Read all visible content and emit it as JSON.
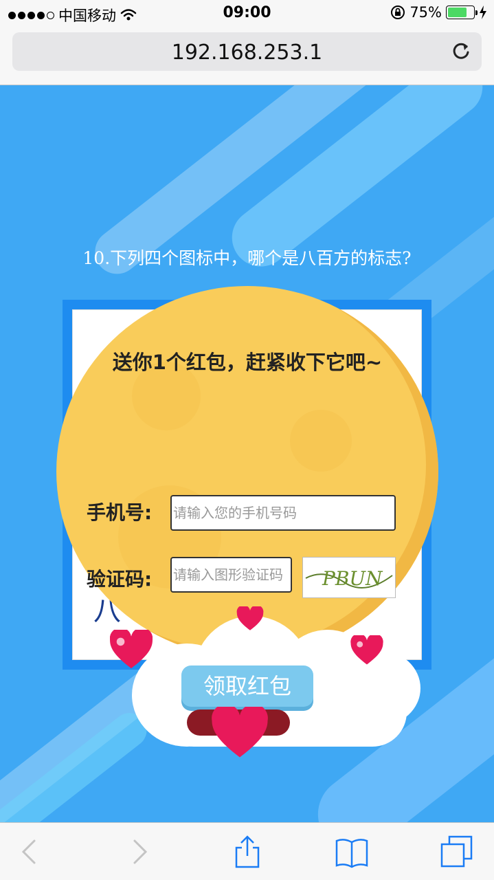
{
  "status": {
    "carrier": "中国移动",
    "time": "09:00",
    "battery": "75%",
    "battery_level": 0.75
  },
  "browser": {
    "url": "192.168.253.1"
  },
  "quiz": {
    "question": "10.下列四个图标中，哪个是八百方的标志?",
    "partial_option_text": "八"
  },
  "popup": {
    "title": "送你1个红包，赶紧收下它吧~",
    "phone_label": "手机号:",
    "phone_placeholder": "请输入您的手机号码",
    "code_label": "验证码:",
    "code_placeholder": "请输入图形验证码",
    "captcha_text": "PBUN",
    "button_label": "领取红包"
  },
  "colors": {
    "page_bg": "#3fa8f4",
    "moon": "#f9cc5a",
    "button": "#7cc9ee",
    "heart": "#e8195a",
    "frame": "#1e8cf0"
  }
}
